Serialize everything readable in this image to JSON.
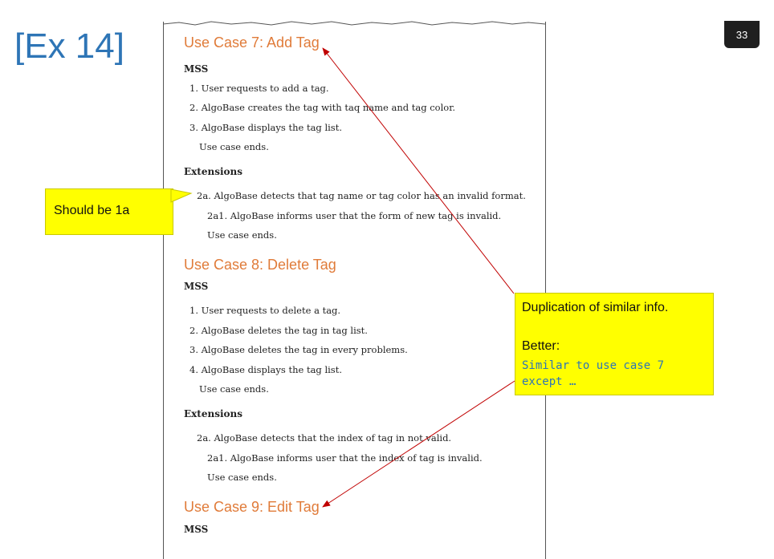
{
  "slide": {
    "title": "[Ex 14]",
    "page_number": "33"
  },
  "document": {
    "uc7": {
      "heading": "Use Case 7: Add Tag",
      "mss_label": "MSS",
      "steps": [
        "1. User requests to add a tag.",
        "2. AlgoBase creates the tag with taq name and tag color.",
        "3. AlgoBase displays the tag list."
      ],
      "end": "Use case ends.",
      "extensions_label": "Extensions",
      "ext": [
        "2a. AlgoBase detects that tag name or tag color has an invalid format.",
        "2a1. AlgoBase informs user that the form of new tag is invalid.",
        "Use case ends."
      ]
    },
    "uc8": {
      "heading": "Use Case 8: Delete Tag",
      "mss_label": "MSS",
      "steps": [
        "1. User requests to delete a tag.",
        "2. AlgoBase deletes the tag in tag list.",
        "3. AlgoBase deletes the tag in every problems.",
        "4. AlgoBase displays the tag list."
      ],
      "end": "Use case ends.",
      "extensions_label": "Extensions",
      "ext": [
        "2a. AlgoBase detects that the index of tag in not valid.",
        "2a1. AlgoBase informs user that the index of tag is invalid.",
        "Use case ends."
      ]
    },
    "uc9": {
      "heading": "Use Case 9: Edit Tag",
      "mss_label": "MSS"
    }
  },
  "callouts": {
    "left": {
      "text": "Should be 1a"
    },
    "right": {
      "line1": "Duplication of similar info.",
      "line2": "Better:",
      "code1": "Similar to use case 7",
      "code2": "except …"
    }
  },
  "colors": {
    "title": "#2e75b6",
    "heading": "#e07b39",
    "callout": "#ffff00",
    "arrow": "#c00000"
  }
}
